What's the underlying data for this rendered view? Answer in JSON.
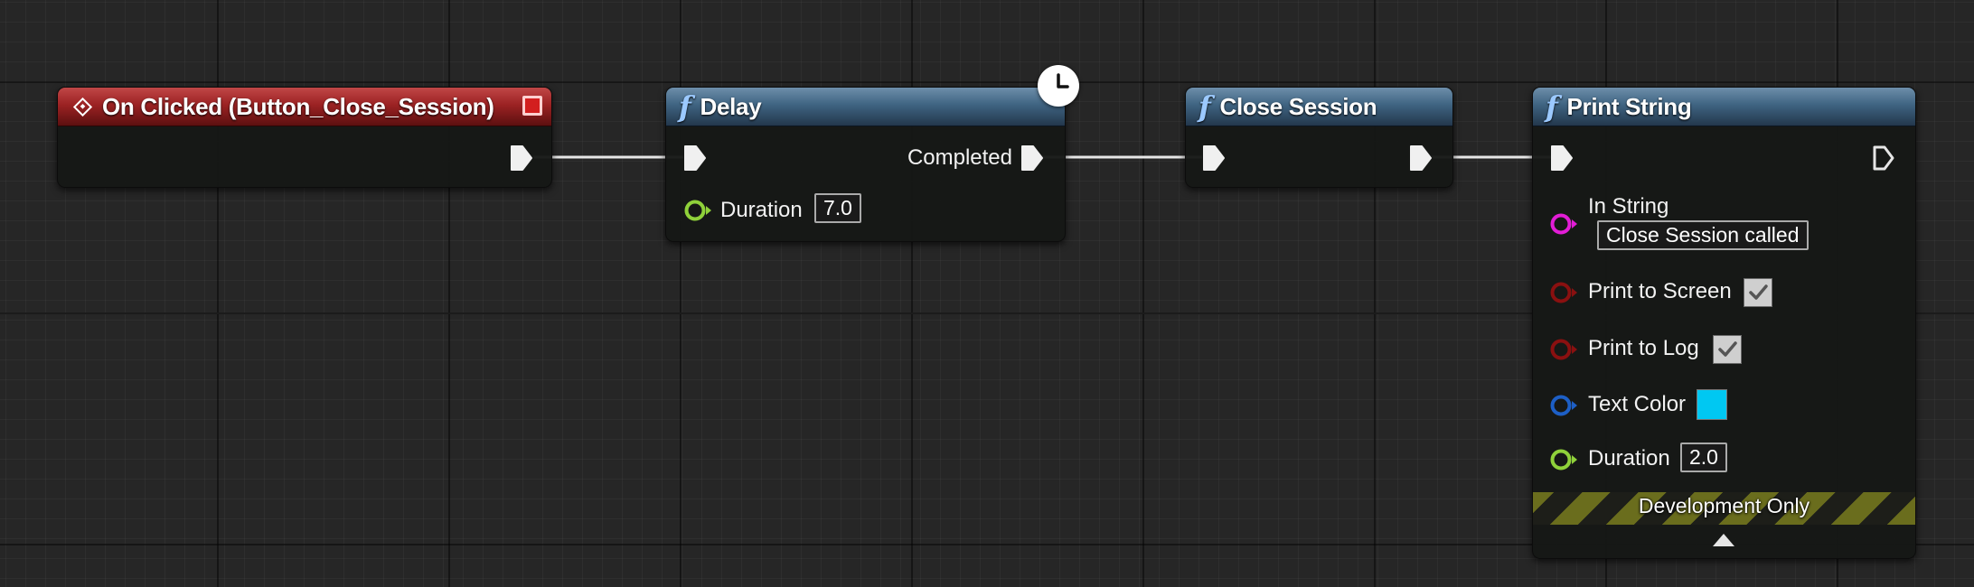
{
  "nodes": {
    "on_clicked": {
      "title": "On Clicked (Button_Close_Session)",
      "icon": "event-diamond-icon",
      "header_color": "#9c2223"
    },
    "delay": {
      "title": "Delay",
      "icon": "function-icon",
      "latent_icon": "clock-icon",
      "outputs": {
        "completed_label": "Completed"
      },
      "inputs": {
        "duration": {
          "label": "Duration",
          "value": "7.0"
        }
      }
    },
    "close_session": {
      "title": "Close Session",
      "icon": "function-icon"
    },
    "print_string": {
      "title": "Print String",
      "icon": "function-icon",
      "inputs": {
        "in_string": {
          "label": "In String",
          "value": "Close Session called",
          "pin_color": "#e21dd6"
        },
        "print_to_screen": {
          "label": "Print to Screen",
          "checked": true,
          "pin_color": "#8a1010"
        },
        "print_to_log": {
          "label": "Print to Log",
          "checked": true,
          "pin_color": "#8a1010"
        },
        "text_color": {
          "label": "Text Color",
          "value": "#00c8f2",
          "pin_color": "#1d5fc6"
        },
        "duration": {
          "label": "Duration",
          "value": "2.0",
          "pin_color": "#8fd13a"
        }
      },
      "footer": {
        "dev_label": "Development Only",
        "collapse_icon": "chevron-up-icon"
      }
    }
  },
  "colors": {
    "function_header": "#3f6482",
    "event_header": "#9c2223",
    "float_pin": "#8fd13a",
    "string_pin": "#e21dd6",
    "bool_pin": "#8a1010",
    "struct_pin": "#1d5fc6",
    "exec_wire": "#e6e6e6"
  }
}
